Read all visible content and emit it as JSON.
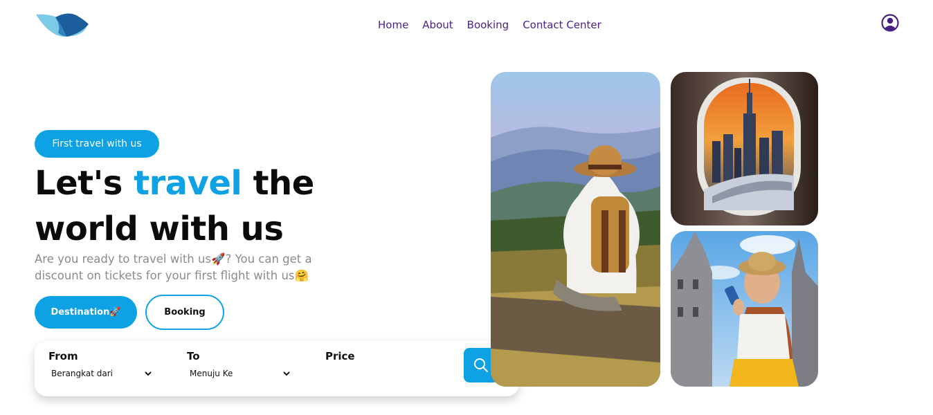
{
  "brand": {
    "logo_icon": "swoosh-eye-logo",
    "primary_color": "#0ea1e4",
    "nav_color": "#4a1f82"
  },
  "nav": {
    "items": [
      {
        "label": "Home"
      },
      {
        "label": "About"
      },
      {
        "label": "Booking"
      },
      {
        "label": "Contact Center"
      }
    ],
    "user_icon": "user-circle-icon"
  },
  "hero": {
    "badge": "First travel with us",
    "headline_part1": "Let's ",
    "headline_accent": "travel",
    "headline_part2": " the world with us",
    "subtext_part1": "Are you ready to travel with us",
    "subtext_emoji1": "🚀",
    "subtext_part2": "? You can get a discount on tickets for your first flight with us",
    "subtext_emoji2": "🤗",
    "destination_button": "Destination",
    "destination_emoji": "🚀",
    "booking_button": "Booking"
  },
  "search": {
    "from_label": "From",
    "from_value": "Berangkat dari",
    "to_label": "To",
    "to_value": "Menuju Ke",
    "price_label": "Price",
    "search_icon": "search-icon"
  },
  "photos": [
    {
      "name": "hiker-photo"
    },
    {
      "name": "airplane-window-photo"
    },
    {
      "name": "tourist-photo"
    }
  ]
}
